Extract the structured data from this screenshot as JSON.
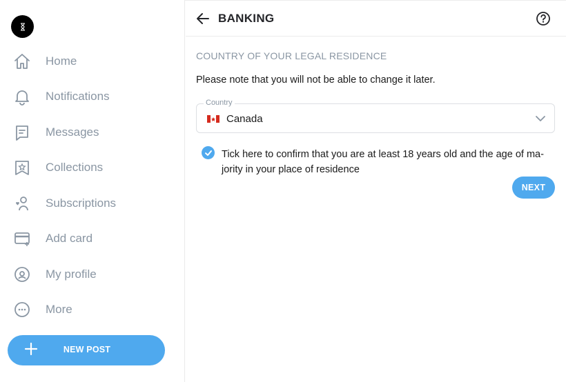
{
  "sidebar": {
    "items": [
      {
        "label": "Home",
        "icon": "home-icon"
      },
      {
        "label": "Notifications",
        "icon": "bell-icon"
      },
      {
        "label": "Messages",
        "icon": "message-icon"
      },
      {
        "label": "Collections",
        "icon": "bookmark-icon"
      },
      {
        "label": "Subscriptions",
        "icon": "user-heart-icon"
      },
      {
        "label": "Add card",
        "icon": "card-plus-icon"
      },
      {
        "label": "My profile",
        "icon": "profile-icon"
      },
      {
        "label": "More",
        "icon": "more-icon"
      }
    ],
    "new_post_label": "NEW POST"
  },
  "header": {
    "title": "BANKING"
  },
  "form": {
    "section_title": "COUNTRY OF YOUR LEGAL RESIDENCE",
    "note": "Please note that you will not be able to change it later.",
    "country_legend": "Country",
    "country_value": "Canada",
    "confirm_text": "Tick here to confirm that you are at least 18 years old and the age of ma-jority in your place of residence",
    "confirm_checked": true,
    "next_label": "NEXT"
  },
  "colors": {
    "accent": "#4fa9ee",
    "muted_text": "#8a96a3"
  }
}
